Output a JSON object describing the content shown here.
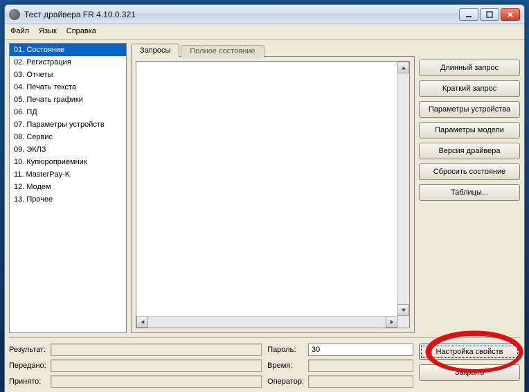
{
  "window": {
    "title": "Тест драйвера FR 4.10.0.321"
  },
  "menu": {
    "file": "Файл",
    "lang": "Язык",
    "help": "Справка"
  },
  "sidebar": {
    "items": [
      "01. Состояние",
      "02. Регистрация",
      "03. Отчеты",
      "04. Печать текста",
      "05. Печать графики",
      "06. ПД",
      "07. Параметры устройств",
      "08. Сервис",
      "09. ЭКЛЗ",
      "10. Купюроприемник",
      "11. MasterPay-K",
      "12. Модем",
      "13. Прочее"
    ],
    "selected": 0
  },
  "tabs": {
    "requests": "Запросы",
    "full_state": "Полное состояние"
  },
  "right_buttons": {
    "long_req": "Длинный запрос",
    "short_req": "Краткий запрос",
    "dev_params": "Параметры устройства",
    "model_params": "Параметры модели",
    "drv_version": "Версия драйвера",
    "reset_state": "Сбросить состояние",
    "tables": "Таблицы..."
  },
  "footer": {
    "result_lbl": "Результат:",
    "sent_lbl": "Передано:",
    "recv_lbl": "Принято:",
    "pwd_lbl": "Пароль:",
    "pwd_val": "30",
    "time_lbl": "Время:",
    "oper_lbl": "Оператор:",
    "props_btn": "Настройка свойств",
    "close_btn": "Закрыть"
  }
}
